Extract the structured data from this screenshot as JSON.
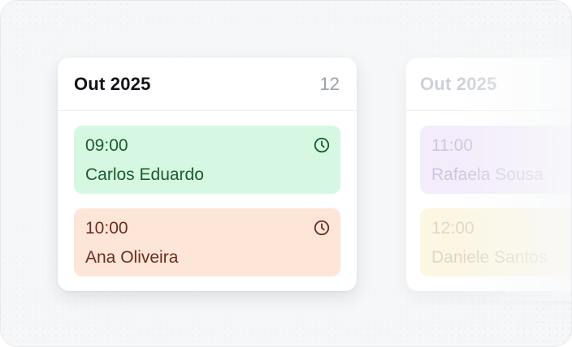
{
  "main_card": {
    "title": "Out 2025",
    "count": "12",
    "appointments": [
      {
        "time": "09:00",
        "name": "Carlos Eduardo",
        "color": "#d6f7e2",
        "icon": "clock-icon"
      },
      {
        "time": "10:00",
        "name": "Ana Oliveira",
        "color": "#fde5d8",
        "icon": "clock-icon"
      }
    ]
  },
  "next_card": {
    "title": "Out 2025",
    "appointments": [
      {
        "time": "11:00",
        "name": "Rafaela Sousa",
        "color": "#f3ecfb"
      },
      {
        "time": "12:00",
        "name": "Daniele Santos",
        "color": "#fbf7e3"
      }
    ]
  }
}
